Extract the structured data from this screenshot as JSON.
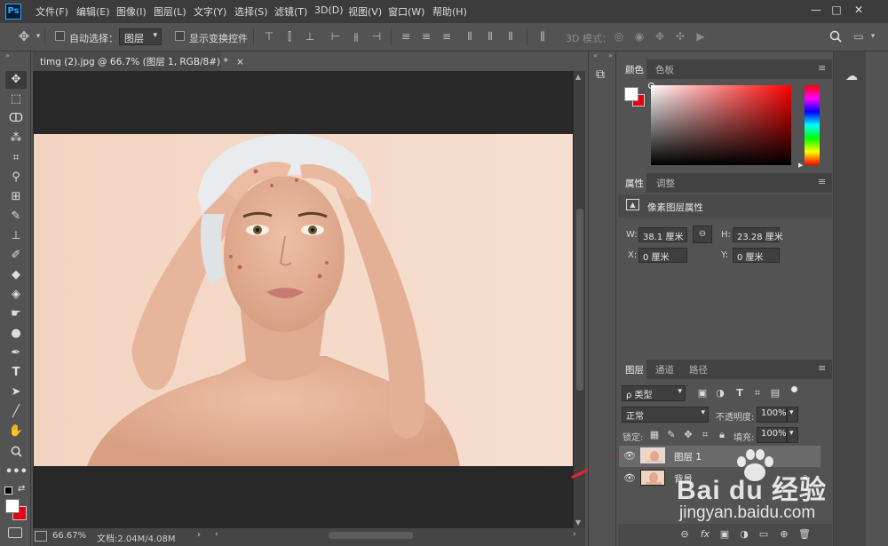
{
  "app": {
    "logo": "Ps"
  },
  "menu": [
    "文件(F)",
    "编辑(E)",
    "图像(I)",
    "图层(L)",
    "文字(Y)",
    "选择(S)",
    "滤镜(T)",
    "3D(D)",
    "视图(V)",
    "窗口(W)",
    "帮助(H)"
  ],
  "window_controls": {
    "minimize": "—",
    "maximize": "□",
    "close": "✕"
  },
  "options": {
    "auto_select_label": "自动选择：",
    "auto_select_value": "图层",
    "show_transform_label": "显示变换控件",
    "mode_3d_label": "3D 模式："
  },
  "document": {
    "tab_title": "timg (2).jpg @ 66.7% (图层 1, RGB/8#) *",
    "tab_close": "×",
    "zoom": "66.67%",
    "doc_info": "文档:2.04M/4.08M"
  },
  "panels": {
    "color": {
      "tabs": [
        "颜色",
        "色板"
      ],
      "fg_color": "#ffffff",
      "bg_color": "#e60012",
      "picker_hue": "#ff0000"
    },
    "properties": {
      "tabs": [
        "属性",
        "调整"
      ],
      "title": "像素图层属性",
      "w_label": "W:",
      "w_value": "38.1 厘米",
      "h_label": "H:",
      "h_value": "23.28 厘米",
      "x_label": "X:",
      "x_value": "0 厘米",
      "y_label": "Y:",
      "y_value": "0 厘米"
    },
    "layers": {
      "tabs": [
        "图层",
        "通道",
        "路径"
      ],
      "filter_value": "ρ 类型",
      "blend_mode": "正常",
      "opacity_label": "不透明度:",
      "opacity_value": "100%",
      "lock_label": "锁定:",
      "fill_label": "填充:",
      "fill_value": "100%",
      "items": [
        {
          "name": "图层 1",
          "selected": true
        },
        {
          "name": "背景",
          "selected": false
        }
      ]
    }
  },
  "watermark": {
    "brand": "Bai du 经验",
    "url": "jingyan.baidu.com"
  },
  "colors": {
    "chrome": "#535353",
    "menubar": "#3c3c3c",
    "canvas_bg": "#282828",
    "photo_bg": "#f2d8c6",
    "annotation_arrow": "#e8232a"
  }
}
